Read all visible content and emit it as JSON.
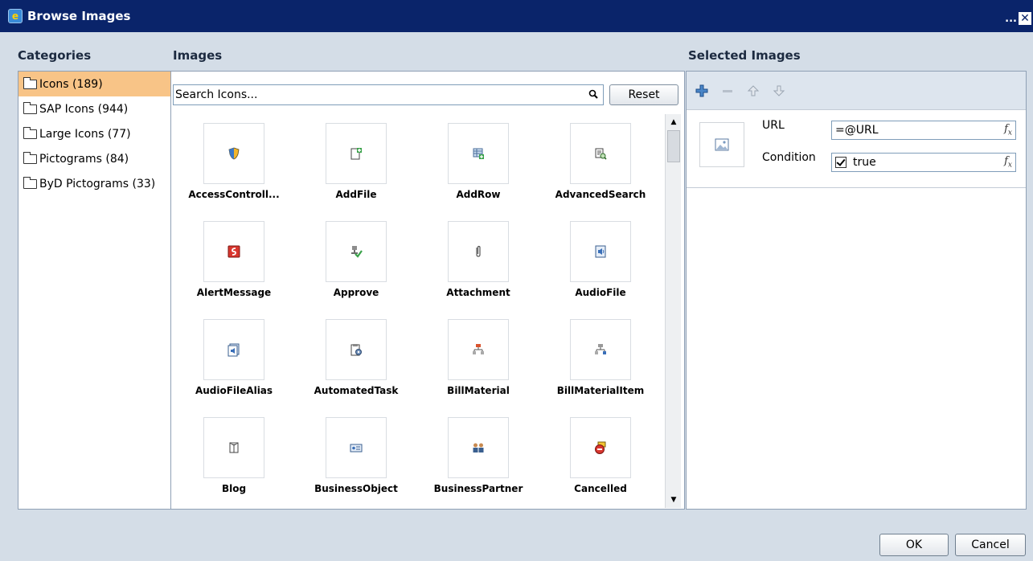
{
  "window": {
    "title": "Browse Images"
  },
  "headers": {
    "categories": "Categories",
    "images": "Images",
    "selected": "Selected Images"
  },
  "categories": [
    {
      "label": "Icons (189)",
      "selected": true
    },
    {
      "label": "SAP Icons (944)",
      "selected": false
    },
    {
      "label": "Large Icons (77)",
      "selected": false
    },
    {
      "label": "Pictograms (84)",
      "selected": false
    },
    {
      "label": "ByD Pictograms (33)",
      "selected": false
    }
  ],
  "search": {
    "placeholder": "Search Icons...",
    "reset_label": "Reset"
  },
  "icons": [
    {
      "label": "AccessControll...",
      "icon": "shield-icon"
    },
    {
      "label": "AddFile",
      "icon": "add-file-icon"
    },
    {
      "label": "AddRow",
      "icon": "add-row-icon"
    },
    {
      "label": "AdvancedSearch",
      "icon": "advanced-search-icon"
    },
    {
      "label": "AlertMessage",
      "icon": "alert-message-icon"
    },
    {
      "label": "Approve",
      "icon": "approve-icon"
    },
    {
      "label": "Attachment",
      "icon": "paperclip-icon"
    },
    {
      "label": "AudioFile",
      "icon": "audio-file-icon"
    },
    {
      "label": "AudioFileAlias",
      "icon": "audio-file-alias-icon"
    },
    {
      "label": "AutomatedTask",
      "icon": "automated-task-icon"
    },
    {
      "label": "BillMaterial",
      "icon": "bill-material-icon"
    },
    {
      "label": "BillMaterialItem",
      "icon": "bill-material-item-icon"
    },
    {
      "label": "Blog",
      "icon": "blog-icon"
    },
    {
      "label": "BusinessObject",
      "icon": "business-object-icon"
    },
    {
      "label": "BusinessPartner",
      "icon": "business-partner-icon"
    },
    {
      "label": "Cancelled",
      "icon": "cancelled-icon"
    }
  ],
  "selected": {
    "url_label": "URL",
    "url_value": "=@URL",
    "condition_label": "Condition",
    "condition_value": "true",
    "condition_checked": true
  },
  "footer": {
    "ok_label": "OK",
    "cancel_label": "Cancel"
  },
  "colors": {
    "titlebar": "#0a246a",
    "selection": "#f8c487",
    "background": "#d4dde7"
  }
}
